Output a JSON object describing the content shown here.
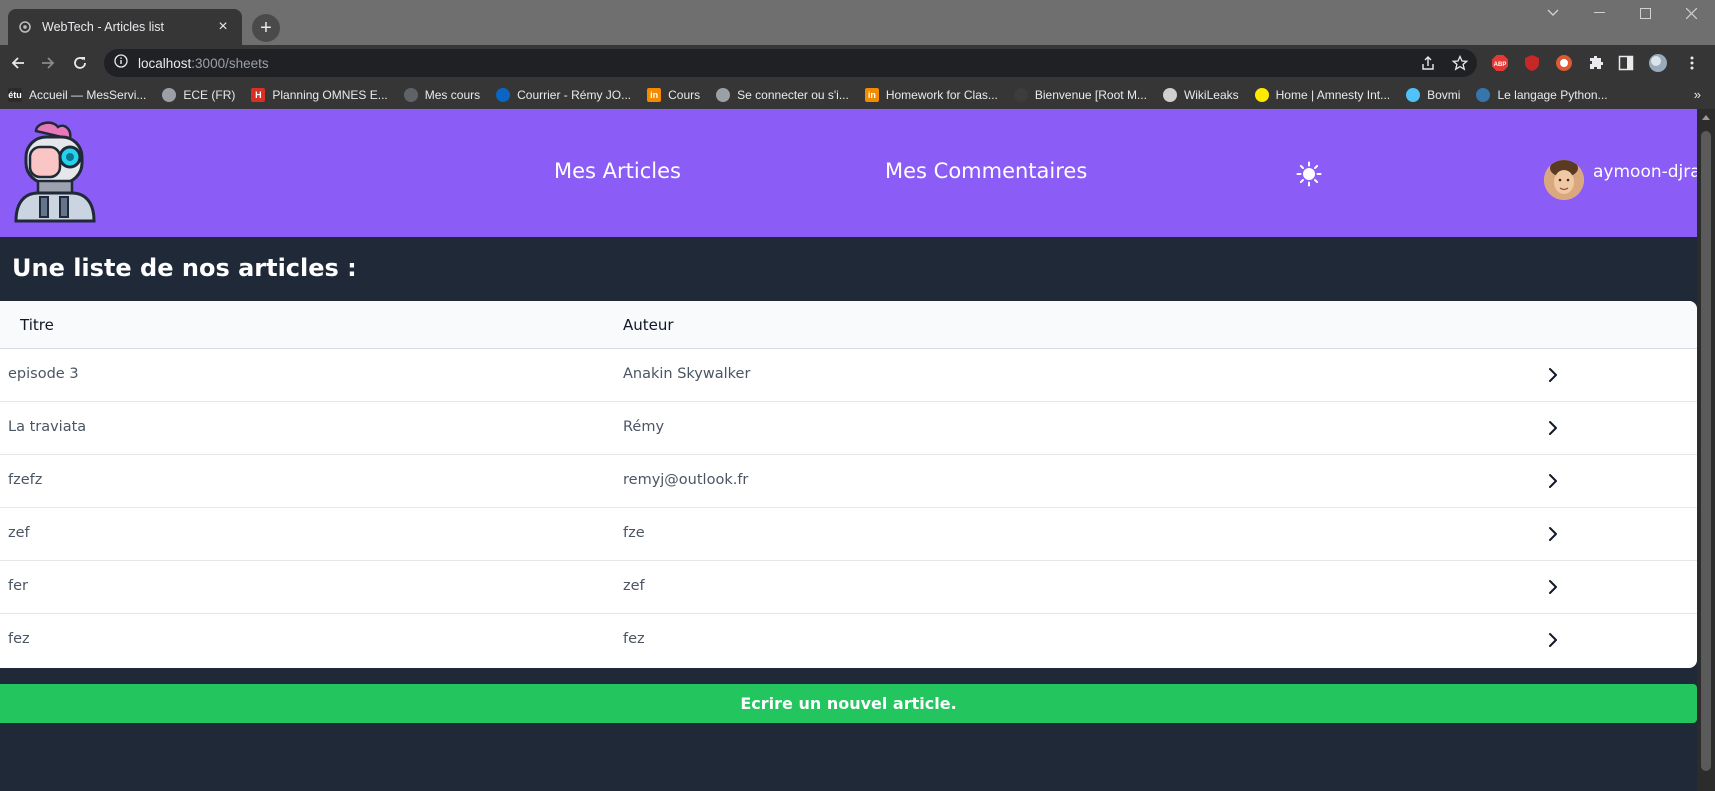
{
  "browser": {
    "tab_title": "WebTech - Articles list",
    "tab_close": "×",
    "new_tab": "+",
    "url_host": "localhost",
    "url_path": ":3000/sheets",
    "bookmarks": [
      {
        "label": "Accueil — MesServi...",
        "icon": "étu",
        "color": "#2b2b2b"
      },
      {
        "label": "ECE (FR)",
        "icon": "globe-icon",
        "color": "#9aa0a6"
      },
      {
        "label": "Planning OMNES E...",
        "icon": "H",
        "color": "#d93025"
      },
      {
        "label": "Mes cours",
        "icon": "moodle-icon",
        "color": "#5f6368"
      },
      {
        "label": "Courrier - Rémy JO...",
        "icon": "outlook-icon",
        "color": "#0a66c2"
      },
      {
        "label": "Cours",
        "icon": "in",
        "color": "#f28b00"
      },
      {
        "label": "Se connecter ou s'i...",
        "icon": "eye-icon",
        "color": "#9aa0a6"
      },
      {
        "label": "Homework for Clas...",
        "icon": "in",
        "color": "#f28b00"
      },
      {
        "label": "Bienvenue [Root M...",
        "icon": "rootme-icon",
        "color": "#3c3c3c"
      },
      {
        "label": "WikiLeaks",
        "icon": "wikileaks-icon",
        "color": "#cfcfcf"
      },
      {
        "label": "Home | Amnesty Int...",
        "icon": "amnesty-icon",
        "color": "#ffeb00"
      },
      {
        "label": "Bovmi",
        "icon": "bulb-icon",
        "color": "#4fc3f7"
      },
      {
        "label": "Le langage Python...",
        "icon": "python-icon",
        "color": "#3776ab"
      }
    ],
    "bookmarks_more": "»"
  },
  "header": {
    "nav": [
      {
        "label": "Mes Articles"
      },
      {
        "label": "Mes Commentaires"
      }
    ],
    "theme_icon": "sun-icon",
    "username": "aymoon-djrak"
  },
  "main": {
    "title": "Une liste de nos articles :",
    "columns": [
      "Titre",
      "Auteur"
    ],
    "rows": [
      {
        "title": "episode 3",
        "author": "Anakin Skywalker"
      },
      {
        "title": "La traviata",
        "author": "Rémy"
      },
      {
        "title": "fzefz",
        "author": "remyj@outlook.fr"
      },
      {
        "title": "zef",
        "author": "fze"
      },
      {
        "title": "fer",
        "author": "zef"
      },
      {
        "title": "fez",
        "author": "fez"
      }
    ],
    "new_article_label": "Ecrire un nouvel article."
  },
  "colors": {
    "header_bg": "#8b5cf6",
    "page_bg": "#1f2937",
    "button_bg": "#22c55e"
  }
}
